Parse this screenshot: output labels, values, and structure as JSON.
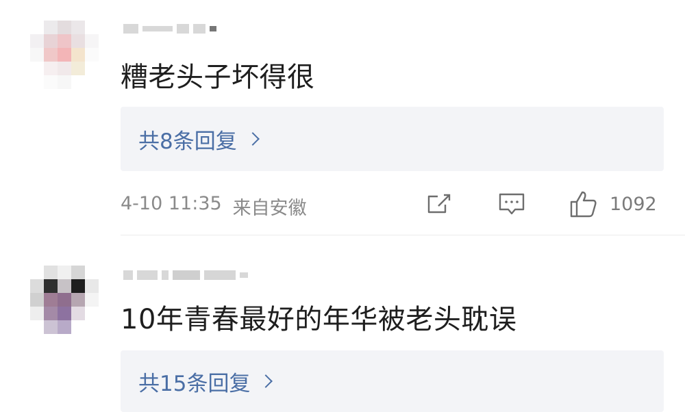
{
  "comments": [
    {
      "text": "糟老头子坏得很",
      "replies_label": "共8条回复",
      "date": "4-10 11:35",
      "location": "来自安徽",
      "likes": "1092"
    },
    {
      "text": "10年青春最好的年华被老头耽误",
      "replies_label": "共15条回复"
    }
  ],
  "icons": {
    "share": "share-icon",
    "comment": "comment-icon",
    "like": "thumbs-up-icon",
    "chevron": "chevron-right-icon"
  },
  "colors": {
    "link": "#4a6ea5",
    "reply_bg": "#f3f4f7",
    "meta": "#8a8a8a"
  }
}
